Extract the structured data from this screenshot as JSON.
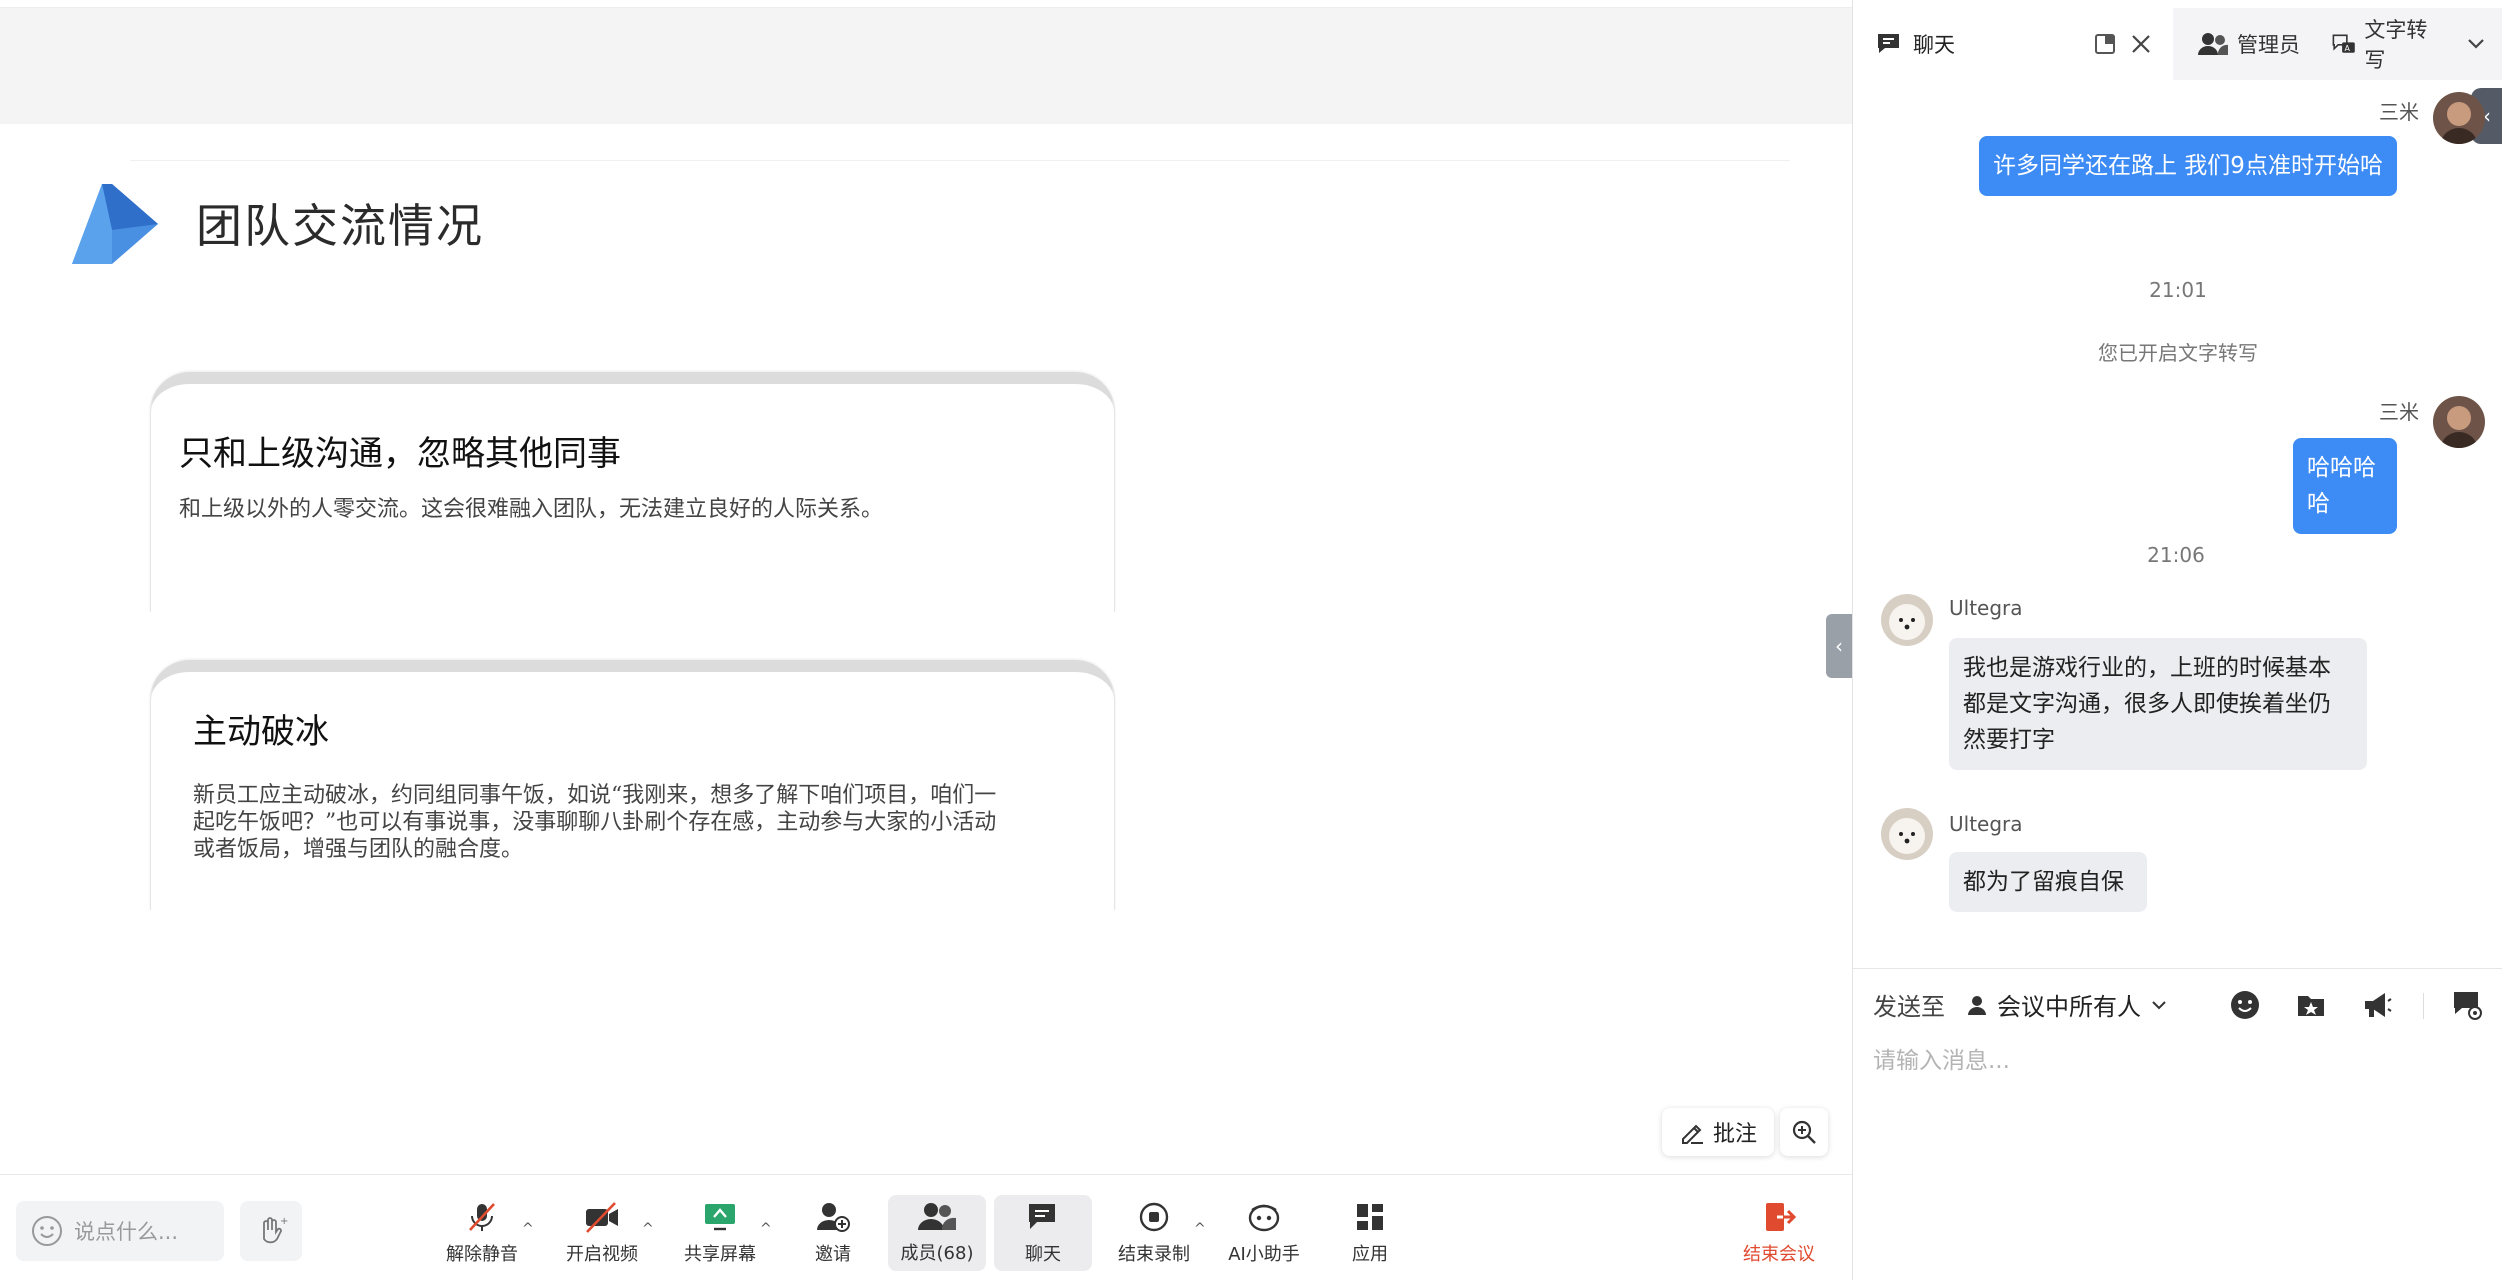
{
  "slide": {
    "title": "团队交流情况",
    "cards": [
      {
        "title": "只和上级沟通，忽略其他同事",
        "text": "和上级以外的人零交流。这会很难融入团队，无法建立良好的人际关系。"
      },
      {
        "title": "主动破冰",
        "text": "新员工应主动破冰，约同组同事午饭，如说“我刚来，想多了解下咱们项目，咱们一起吃午饭吧？”也可以有事说事，没事聊聊八卦刷个存在感，主动参与大家的小活动或者饭局，增强与团队的融合度。"
      }
    ]
  },
  "floating": {
    "annotate_label": "批注"
  },
  "toolbar": {
    "say_placeholder": "说点什么...",
    "items": {
      "unmute": "解除静音",
      "video": "开启视频",
      "share": "共享屏幕",
      "invite": "邀请",
      "members": "成员(68)",
      "chat": "聊天",
      "stop_record": "结束录制",
      "ai_assistant": "AI小助手",
      "apps": "应用",
      "end_meeting": "结束会议"
    }
  },
  "panel": {
    "tabs": {
      "chat": "聊天",
      "manage": "管理员",
      "transcript": "文字转写"
    },
    "messages": [
      {
        "sender": "三米",
        "text": "许多同学还在路上 我们9点准时开始哈"
      },
      {
        "time": "21:01"
      },
      {
        "system": "您已开启文字转写"
      },
      {
        "sender": "三米",
        "text": "哈哈哈哈"
      },
      {
        "time": "21:06"
      },
      {
        "sender": "Ultegra",
        "text": "我也是游戏行业的，上班的时候基本都是文字沟通，很多人即使挨着坐仍然要打字"
      },
      {
        "sender": "Ultegra",
        "text": "都为了留痕自保"
      }
    ],
    "compose": {
      "send_to_label": "发送至",
      "target": "会议中所有人",
      "placeholder": "请输入消息..."
    }
  },
  "colors": {
    "accent_blue": "#3d8bf5",
    "end_red": "#e04a2f",
    "logo_blue": "#2f6fc9"
  }
}
